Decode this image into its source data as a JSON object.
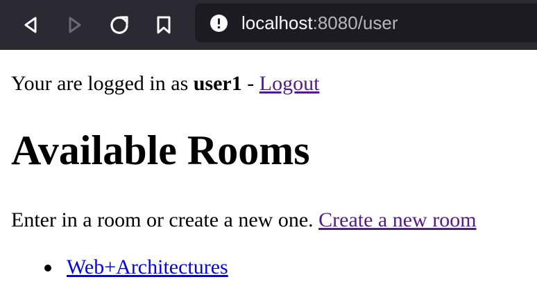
{
  "browser": {
    "back_icon": "back-arrow-icon",
    "forward_icon": "forward-arrow-icon",
    "reload_icon": "reload-icon",
    "bookmark_icon": "bookmark-icon",
    "info_icon": "info-icon",
    "url_host": "localhost",
    "url_rest": ":8080/user",
    "toolbar_color": "#2b2a33",
    "urlbar_color": "#1c1b22"
  },
  "page": {
    "login_prefix": "Your are logged in as ",
    "username": "user1",
    "login_separator": " - ",
    "logout_label": "Logout",
    "title": "Available Rooms",
    "intro_text": "Enter in a room or create a new one. ",
    "create_room_label": "Create a new room",
    "rooms": [
      {
        "label": "Web+Architectures"
      }
    ],
    "visited_link_color": "#551a8b",
    "unvisited_link_color": "#0000ee"
  }
}
